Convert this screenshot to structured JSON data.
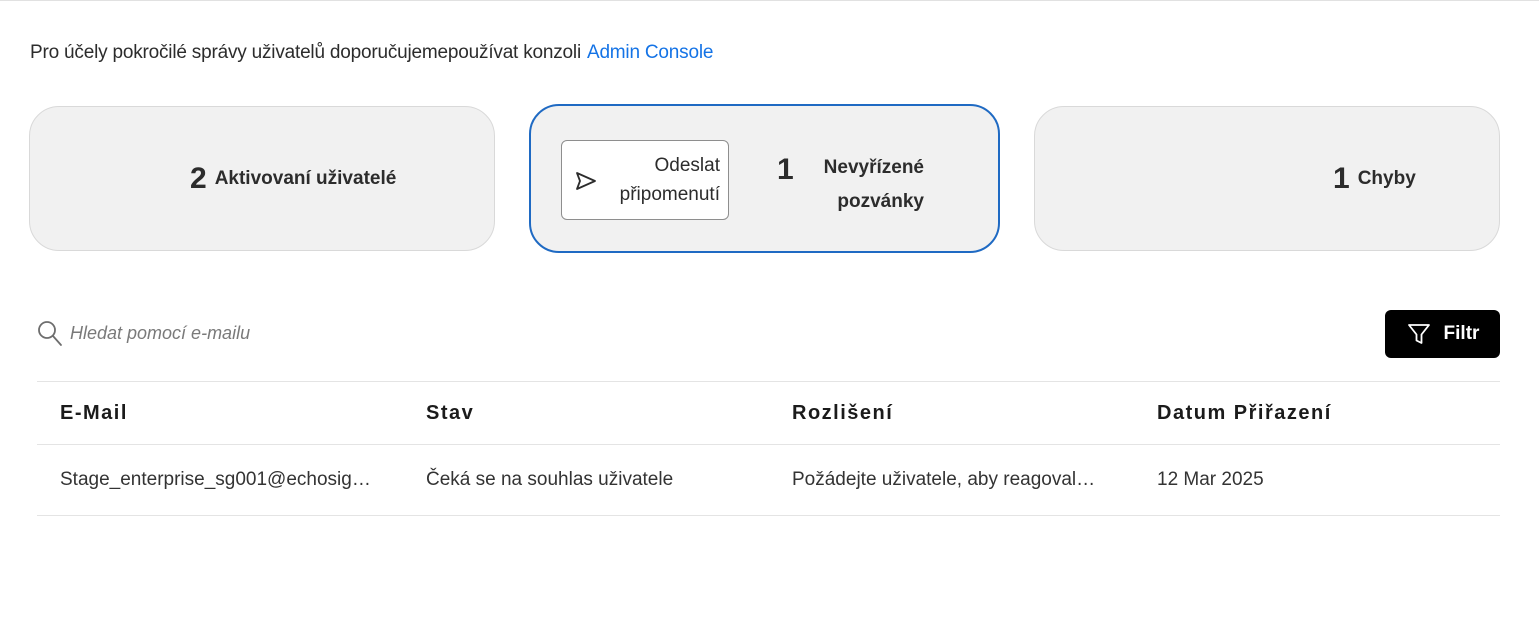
{
  "notice": {
    "text": "Pro účely pokročilé správy uživatelů doporučujemepoužívat konzoli",
    "link_label": "Admin Console"
  },
  "cards": {
    "activated": {
      "count": "2",
      "label": "Aktivovaní uživatelé"
    },
    "pending": {
      "remind_line1": "Odeslat",
      "remind_line2": "připomenutí",
      "count": "1",
      "label_line1": "Nevyřízené",
      "label_line2": "pozvánky"
    },
    "errors": {
      "count": "1",
      "label": "Chyby"
    }
  },
  "search": {
    "placeholder": "Hledat pomocí e-mailu",
    "value": ""
  },
  "filter": {
    "label": "Filtr"
  },
  "table": {
    "headers": [
      "E-Mail",
      "Stav",
      "Rozlišení",
      "Datum Přiřazení"
    ],
    "rows": [
      [
        "Stage_enterprise_sg001@echosig…",
        "Čeká se na souhlas uživatele",
        "Požádejte uživatele, aby reagoval…",
        "12 Mar 2025"
      ]
    ]
  },
  "colors": {
    "link": "#1473e6",
    "active_border": "#1f6ac3",
    "card_bg": "#f1f1f1",
    "button_dark": "#000000"
  },
  "icons": {
    "search": "search-icon",
    "send": "send-icon",
    "filter": "filter-funnel-icon"
  }
}
